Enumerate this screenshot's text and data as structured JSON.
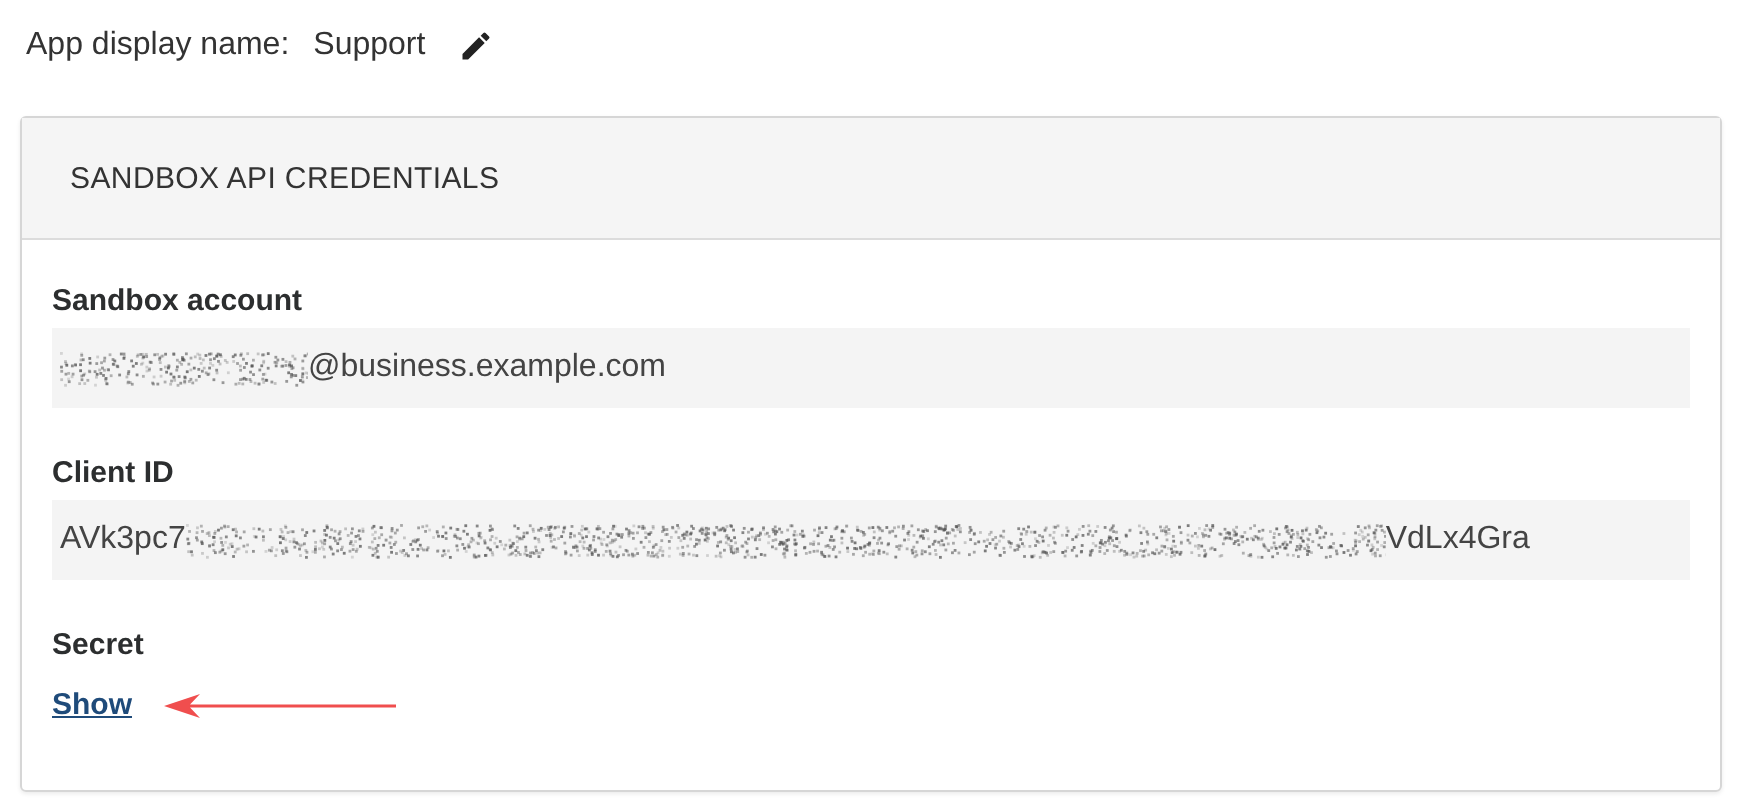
{
  "app_name": {
    "label": "App display name:",
    "value": "Support"
  },
  "card": {
    "title": "SANDBOX API CREDENTIALS",
    "fields": [
      {
        "label": "Sandbox account",
        "parts": [
          {
            "kind": "redacted"
          },
          {
            "kind": "text",
            "text": "@business.example.com"
          }
        ]
      },
      {
        "label": "Client ID",
        "parts": [
          {
            "kind": "text",
            "text": "AVk3pc7"
          },
          {
            "kind": "redacted"
          },
          {
            "kind": "text",
            "text": "VdLx4Gra"
          }
        ]
      }
    ],
    "secret": {
      "label": "Secret",
      "link": "Show",
      "pointer_arrow": true
    }
  }
}
